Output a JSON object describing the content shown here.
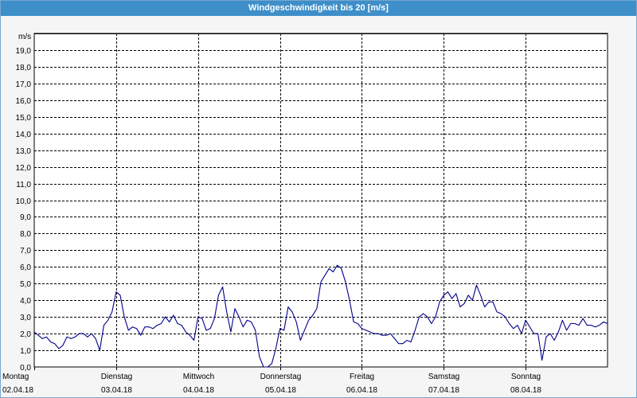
{
  "window": {
    "title": "Windgeschwindigkeit bis 20 [m/s]"
  },
  "colors": {
    "titlebar": "#3e8fc9",
    "line": "#00008b",
    "grid": "#000000",
    "plot_background": "#ffffff"
  },
  "chart_data": {
    "type": "line",
    "title": "Windgeschwindigkeit bis 20 [m/s]",
    "ylabel": "m/s",
    "xlabel": "",
    "ylim": [
      0,
      20
    ],
    "xlim": [
      0,
      7
    ],
    "grid": true,
    "y_ticks": [
      "0,0",
      "1,0",
      "2,0",
      "3,0",
      "4,0",
      "5,0",
      "6,0",
      "7,0",
      "8,0",
      "9,0",
      "10,0",
      "11,0",
      "12,0",
      "13,0",
      "14,0",
      "15,0",
      "16,0",
      "17,0",
      "18,0",
      "19,0"
    ],
    "x_ticks": [
      {
        "day": "Montag",
        "date": "02.04.18"
      },
      {
        "day": "Dienstag",
        "date": "03.04.18"
      },
      {
        "day": "Mittwoch",
        "date": "04.04.18"
      },
      {
        "day": "Donnerstag",
        "date": "05.04.18"
      },
      {
        "day": "Freitag",
        "date": "06.04.18"
      },
      {
        "day": "Samstag",
        "date": "07.04.18"
      },
      {
        "day": "Sonntag",
        "date": "08.04.18"
      }
    ],
    "series": [
      {
        "x": [
          0.0,
          0.05,
          0.1,
          0.15,
          0.2,
          0.25,
          0.3,
          0.35,
          0.4,
          0.45,
          0.5,
          0.55,
          0.6,
          0.65,
          0.7,
          0.75,
          0.8,
          0.85,
          0.9,
          0.95,
          1.0,
          1.05,
          1.1,
          1.15,
          1.2,
          1.25,
          1.3,
          1.35,
          1.4,
          1.45,
          1.5,
          1.55,
          1.6,
          1.65,
          1.7,
          1.75,
          1.8,
          1.85,
          1.9,
          1.95,
          2.0,
          2.05,
          2.1,
          2.15,
          2.2,
          2.25,
          2.3,
          2.35,
          2.4,
          2.45,
          2.5,
          2.55,
          2.6,
          2.65,
          2.7,
          2.75,
          2.8,
          2.85,
          2.9,
          2.95,
          3.0,
          3.05,
          3.1,
          3.15,
          3.2,
          3.25,
          3.3,
          3.35,
          3.4,
          3.45,
          3.5,
          3.55,
          3.6,
          3.65,
          3.7,
          3.75,
          3.8,
          3.85,
          3.9,
          3.95,
          4.0,
          4.05,
          4.1,
          4.15,
          4.2,
          4.25,
          4.3,
          4.35,
          4.4,
          4.45,
          4.5,
          4.55,
          4.6,
          4.65,
          4.7,
          4.75,
          4.8,
          4.85,
          4.9,
          4.95,
          5.0,
          5.05,
          5.1,
          5.15,
          5.2,
          5.25,
          5.3,
          5.35,
          5.4,
          5.45,
          5.5,
          5.55,
          5.6,
          5.65,
          5.7,
          5.75,
          5.8,
          5.85,
          5.9,
          5.95,
          6.0,
          6.05,
          6.1,
          6.15,
          6.2,
          6.25,
          6.3,
          6.35,
          6.4,
          6.45,
          6.5,
          6.55,
          6.6,
          6.65,
          6.7,
          6.75,
          6.8,
          6.85,
          6.9,
          6.95,
          7.0
        ],
        "y": [
          2.1,
          1.9,
          1.7,
          1.8,
          1.5,
          1.4,
          1.1,
          1.3,
          1.8,
          1.7,
          1.8,
          2.0,
          2.0,
          1.8,
          2.0,
          1.7,
          1.0,
          2.5,
          2.8,
          3.3,
          4.5,
          4.3,
          3.0,
          2.2,
          2.4,
          2.3,
          1.9,
          2.4,
          2.4,
          2.3,
          2.5,
          2.6,
          3.0,
          2.7,
          3.1,
          2.6,
          2.5,
          2.1,
          1.9,
          1.6,
          3.0,
          2.9,
          2.2,
          2.3,
          2.9,
          4.3,
          4.8,
          3.3,
          2.1,
          3.5,
          3.0,
          2.4,
          2.8,
          2.7,
          2.2,
          0.6,
          0.0,
          0.0,
          0.2,
          1.1,
          2.3,
          2.2,
          3.6,
          3.3,
          2.7,
          1.6,
          2.2,
          2.8,
          3.1,
          3.5,
          5.1,
          5.5,
          5.9,
          5.7,
          6.1,
          5.9,
          5.1,
          4.0,
          2.7,
          2.6,
          2.3,
          2.2,
          2.1,
          2.0,
          2.0,
          1.9,
          1.9,
          2.0,
          1.7,
          1.4,
          1.4,
          1.6,
          1.5,
          2.2,
          3.0,
          3.2,
          3.0,
          2.6,
          3.0,
          3.9,
          4.3,
          4.5,
          4.1,
          4.4,
          3.6,
          3.8,
          4.3,
          4.0,
          4.9,
          4.3,
          3.6,
          3.9,
          3.9,
          3.3,
          3.2,
          3.0,
          2.6,
          2.3,
          2.5,
          2.0,
          2.8,
          2.4,
          2.0,
          2.0,
          0.4,
          1.8,
          2.0,
          1.6,
          2.1,
          2.8,
          2.2,
          2.6,
          2.6,
          2.5,
          2.9,
          2.5,
          2.5,
          2.4,
          2.5,
          2.7,
          2.6
        ]
      }
    ]
  }
}
